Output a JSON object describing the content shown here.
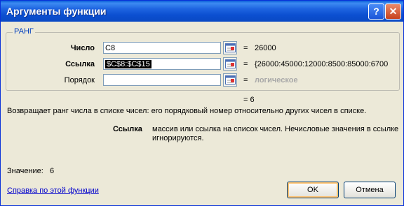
{
  "window": {
    "title": "Аргументы функции",
    "help_glyph": "?",
    "close_glyph": "✕"
  },
  "group": {
    "title": "РАНГ",
    "rows": [
      {
        "label": "Число",
        "value": "C8",
        "result": "26000"
      },
      {
        "label": "Ссылка",
        "value": "$C$8:$C$15",
        "result": "{26000:45000:12000:8500:85000:6700"
      },
      {
        "label": "Порядок",
        "value": "",
        "result": "логическое"
      }
    ],
    "equals": "="
  },
  "formula_result": "= 6",
  "description": "Возвращает ранг числа в списке чисел: его порядковый номер относительно других чисел в списке.",
  "argument_help": {
    "name": "Ссылка",
    "text": "массив или ссылка на список чисел. Нечисловые значения в ссылке игнорируются."
  },
  "value_line": {
    "label": "Значение:",
    "value": "6"
  },
  "help_link": "Справка по этой функции",
  "buttons": {
    "ok": "OK",
    "cancel": "Отмена"
  },
  "colors": {
    "titlebar": "#0a49c4",
    "dialog_bg": "#ece9d8",
    "link": "#0000cc",
    "group_title": "#003fbf"
  }
}
